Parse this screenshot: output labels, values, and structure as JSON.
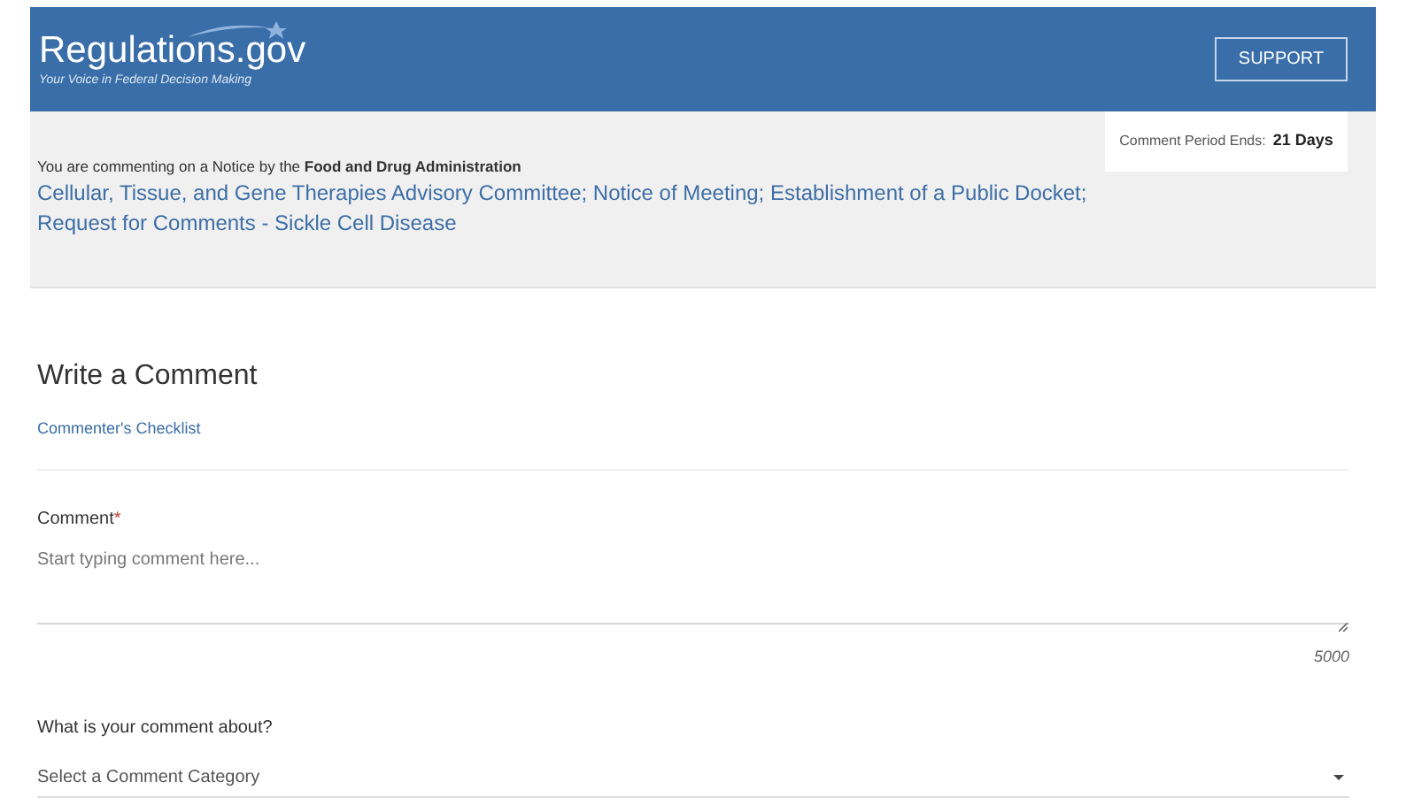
{
  "header": {
    "logo": "Regulations.gov",
    "tagline": "Your Voice in Federal Decision Making",
    "support_button": "SUPPORT"
  },
  "notice": {
    "intro": "You are commenting on a Notice by the **Food and Drug Administration**",
    "title": "Cellular, Tissue, and Gene Therapies Advisory Committee; Notice of Meeting; Establishment of a Public Docket; Request for Comments - Sickle Cell Disease",
    "period_label": "Comment Period Ends:",
    "period_value": "21 Days"
  },
  "form": {
    "heading": "Write a Comment",
    "checklist_link": "Commenter's Checklist",
    "comment": {
      "label": "Comment",
      "required_mark": "*",
      "placeholder": "Start typing comment here...",
      "counter": "5000"
    },
    "category": {
      "label": "What is your comment about?",
      "placeholder": "Select a Comment Category"
    }
  }
}
